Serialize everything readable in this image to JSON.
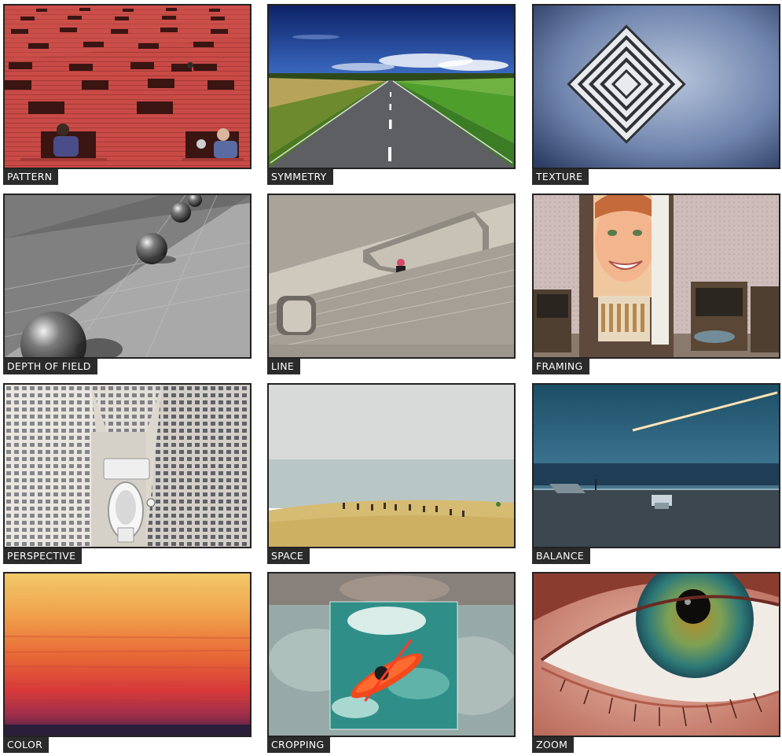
{
  "tiles": [
    {
      "label": "PATTERN"
    },
    {
      "label": "SYMMETRY"
    },
    {
      "label": "TEXTURE"
    },
    {
      "label": "DEPTH OF FIELD"
    },
    {
      "label": "LINE"
    },
    {
      "label": "FRAMING"
    },
    {
      "label": "PERSPECTIVE"
    },
    {
      "label": "SPACE"
    },
    {
      "label": "BALANCE"
    },
    {
      "label": "COLOR"
    },
    {
      "label": "CROPPING"
    },
    {
      "label": "ZOOM"
    }
  ]
}
